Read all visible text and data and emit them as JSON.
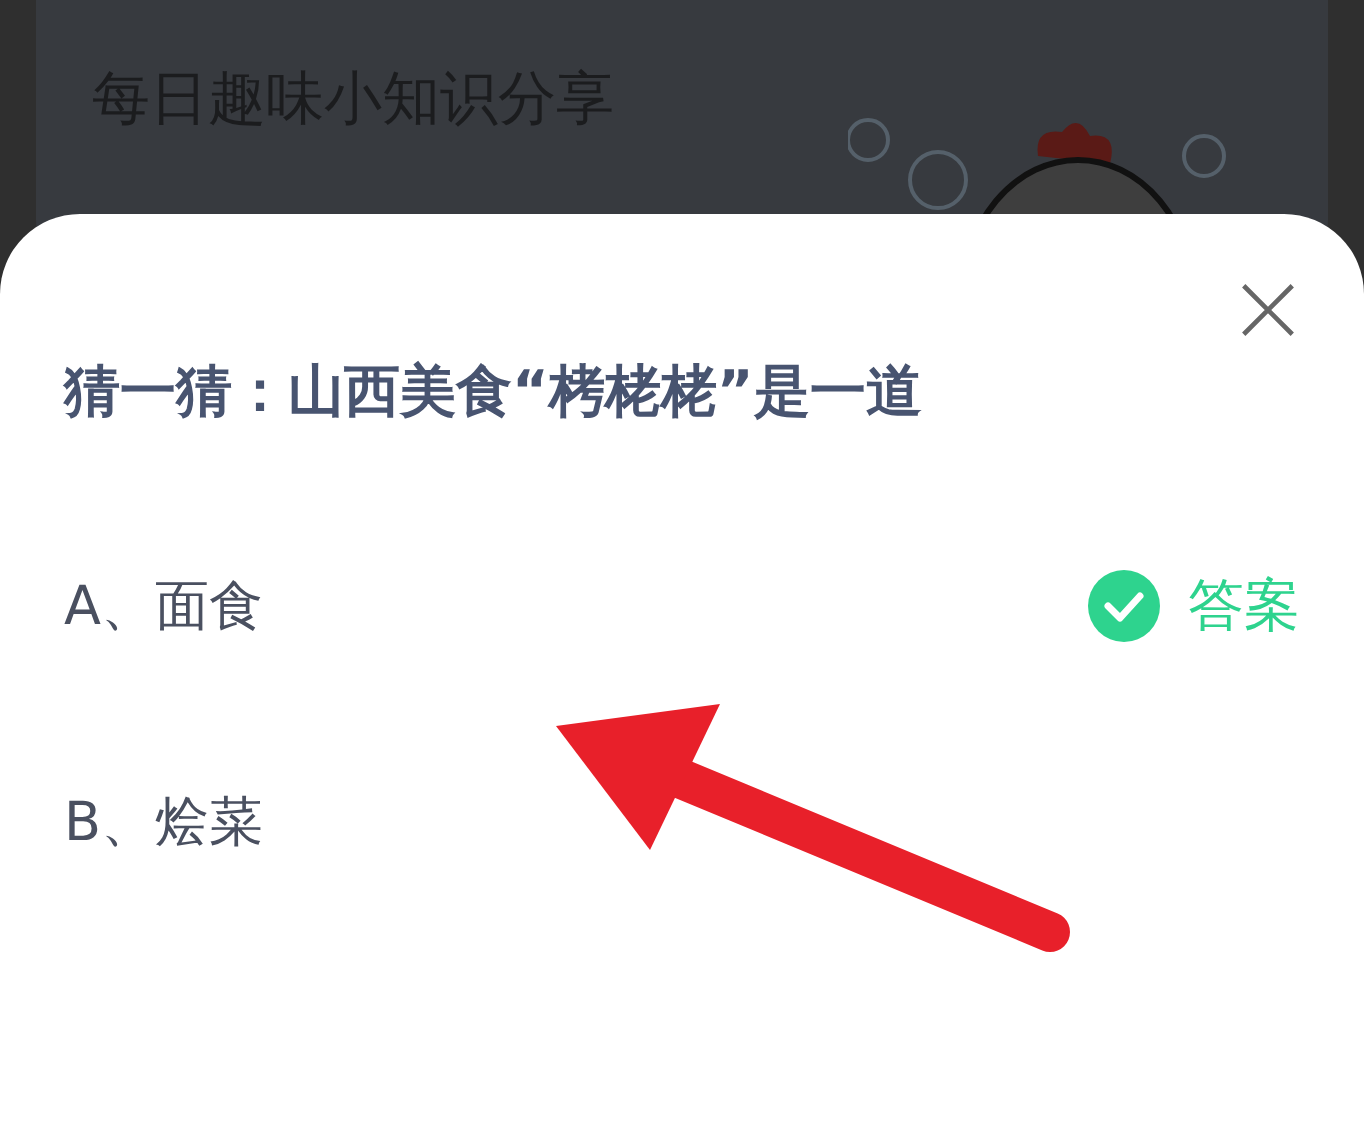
{
  "banner": {
    "title": "每日趣味小知识分享"
  },
  "sheet": {
    "question": "猜一猜：山西美食“栲栳栳”是一道",
    "answer_label": "答案",
    "options": [
      {
        "label": "A、面食",
        "correct": true
      },
      {
        "label": "B、烩菜",
        "correct": false
      }
    ]
  }
}
